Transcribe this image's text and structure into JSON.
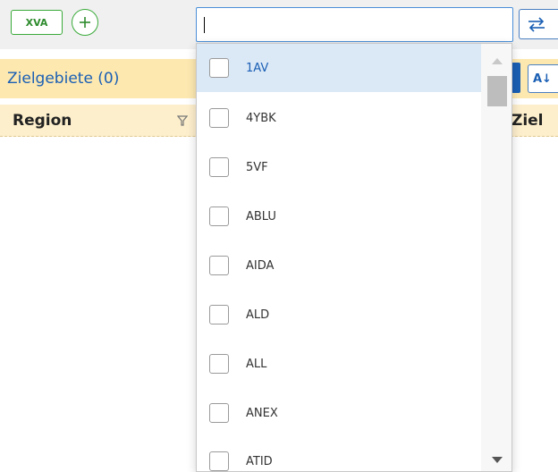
{
  "toolbar": {
    "xva_label": "XVA",
    "add_icon": "plus-circle-icon",
    "search_value": "",
    "swap_icon": "swap-arrows-icon"
  },
  "panel": {
    "title": "Zielgebiete (0)",
    "sort_label": "A↓"
  },
  "columns": {
    "region": "Region",
    "ziel": "Ziel",
    "filter_icon": "filter-icon"
  },
  "dropdown": {
    "options": [
      {
        "label": "1AV",
        "checked": false,
        "highlighted": true
      },
      {
        "label": "4YBK",
        "checked": false,
        "highlighted": false
      },
      {
        "label": "5VF",
        "checked": false,
        "highlighted": false
      },
      {
        "label": "ABLU",
        "checked": false,
        "highlighted": false
      },
      {
        "label": "AIDA",
        "checked": false,
        "highlighted": false
      },
      {
        "label": "ALD",
        "checked": false,
        "highlighted": false
      },
      {
        "label": "ALL",
        "checked": false,
        "highlighted": false
      },
      {
        "label": "ANEX",
        "checked": false,
        "highlighted": false
      },
      {
        "label": "ATID",
        "checked": false,
        "highlighted": false
      }
    ]
  },
  "colors": {
    "accent_blue": "#1a5fb4",
    "accent_green": "#3aaa3a",
    "header_bg": "#fde8b0",
    "highlight_bg": "#dbe9f7"
  }
}
